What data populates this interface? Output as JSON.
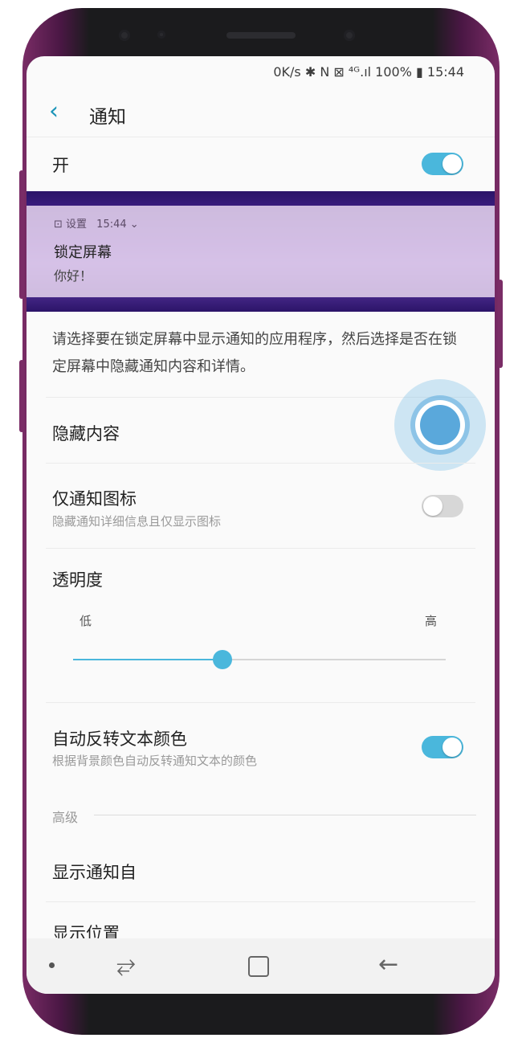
{
  "status_bar": {
    "text": "0K/s ✱ N ⊠ ⁴ᴳ.ıl 100% ▮ 15:44"
  },
  "header": {
    "title": "通知"
  },
  "master_toggle": {
    "label": "开",
    "state": "on"
  },
  "preview": {
    "app": "⊡ 设置",
    "time": "15:44 ⌄",
    "title": "锁定屏幕",
    "body": "你好！"
  },
  "description": "请选择要在锁定屏幕中显示通知的应用程序，然后选择是否在锁定屏幕中隐藏通知内容和详情。",
  "hide_content": {
    "label": "隐藏内容"
  },
  "icons_only": {
    "label": "仅通知图标",
    "sub": "隐藏通知详细信息且仅显示图标",
    "state": "off"
  },
  "transparency": {
    "label": "透明度",
    "low": "低",
    "high": "高",
    "value": 0.4
  },
  "auto_invert": {
    "label": "自动反转文本颜色",
    "sub": "根据背景颜色自动反转通知文本的颜色",
    "state": "on"
  },
  "advanced": {
    "label": "高级"
  },
  "show_from": {
    "label": "显示通知自"
  },
  "position": {
    "label": "显示位置"
  },
  "colors": {
    "accent": "#4ab7dc",
    "phone_frame": "#7a2c66"
  }
}
